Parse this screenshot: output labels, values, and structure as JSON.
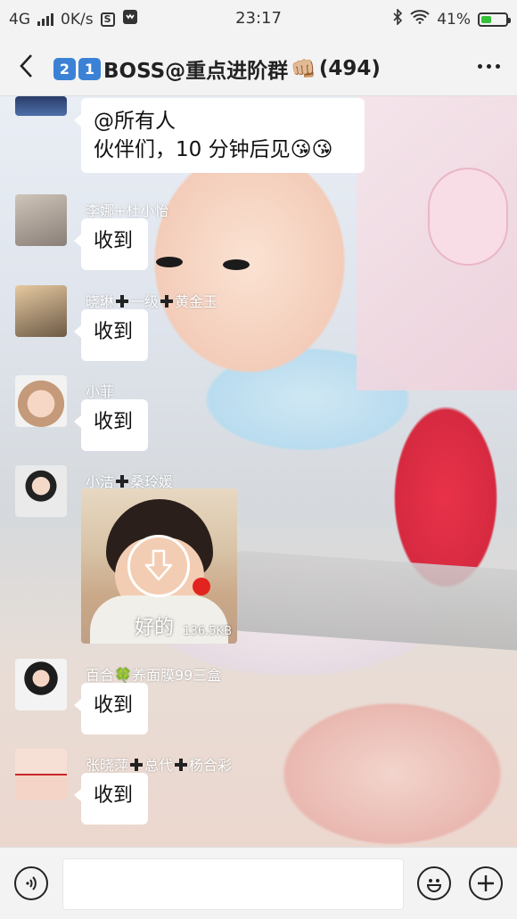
{
  "status_bar": {
    "network": "4G",
    "speed": "0K/s",
    "s_icon": "S",
    "time": "23:17",
    "battery": "41%",
    "battery_level": 0.41
  },
  "header": {
    "badges": [
      "2",
      "1"
    ],
    "title": "BOSS@重点进阶群",
    "count": "(494)",
    "emoji": "👊🏼"
  },
  "messages": [
    {
      "sender": "",
      "text_line1": "@所有人",
      "text_line2": "伙伴们，10 分钟后见",
      "emoji": "😘😘"
    },
    {
      "sender": "李娜+杜小怡",
      "text": "收到"
    },
    {
      "sender_a": "晓琳",
      "sender_b": "一级",
      "sender_c": "黄金玉",
      "text": "收到"
    },
    {
      "sender": "小菲",
      "text": "收到"
    },
    {
      "sender_a": "小洁",
      "sender_b": "桑玲媛",
      "image_caption": "好的",
      "image_size": "136.5KB"
    },
    {
      "sender_a": "百合",
      "sender_b": "养面膜99三盒",
      "clover": "🍀",
      "text": "收到"
    },
    {
      "sender_a": "张晓萍",
      "sender_b": "总代",
      "sender_c": "杨合彩",
      "text": "收到"
    }
  ],
  "input": {
    "placeholder": ""
  },
  "colors": {
    "bar_bg": "#f3f3f3",
    "badge_blue": "#3b82d6",
    "battery_green": "#35c23a"
  },
  "icons": [
    "back-arrow-icon",
    "more-icon",
    "voice-icon",
    "emoji-icon",
    "add-icon",
    "download-icon",
    "bluetooth-icon",
    "wifi-icon",
    "signal-icon",
    "battery-icon"
  ]
}
